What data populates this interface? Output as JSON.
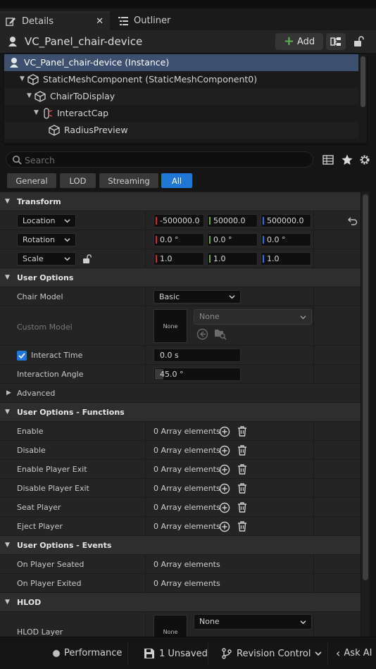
{
  "tabs": {
    "details_label": "Details",
    "close_glyph": "✕",
    "outliner_label": "Outliner"
  },
  "actor": {
    "name": "VC_Panel_chair-device",
    "add_label": "Add"
  },
  "tree": [
    {
      "label": "VC_Panel_chair-device (Instance)",
      "icon": "actor-icon"
    },
    {
      "label": "StaticMeshComponent (StaticMeshComponent0)",
      "icon": "cube-icon"
    },
    {
      "label": "ChairToDisplay",
      "icon": "cube-icon"
    },
    {
      "label": "InteractCap",
      "icon": "capsule-icon"
    },
    {
      "label": "RadiusPreview",
      "icon": "cube-icon"
    }
  ],
  "search": {
    "placeholder": "Search"
  },
  "filters": [
    "General",
    "LOD",
    "Streaming",
    "All"
  ],
  "active_filter": "All",
  "transform": {
    "header": "Transform",
    "location_label": "Location",
    "location": [
      "-500000.0",
      "50000.0",
      "500000.0"
    ],
    "rotation_label": "Rotation",
    "rotation": [
      "0.0 °",
      "0.0 °",
      "0.0 °"
    ],
    "scale_label": "Scale",
    "scale": [
      "1.0",
      "1.0",
      "1.0"
    ]
  },
  "user_options": {
    "header": "User Options",
    "chair_model_label": "Chair Model",
    "chair_model_value": "Basic",
    "custom_model_label": "Custom Model",
    "custom_model_thumb": "None",
    "custom_model_value": "None",
    "interact_time_label": "Interact Time",
    "interact_time_value": "0.0 s",
    "interaction_angle_label": "Interaction Angle",
    "interaction_angle_value": "45.0 °",
    "advanced_label": "Advanced"
  },
  "functions": {
    "header": "User Options - Functions",
    "rows": [
      {
        "label": "Enable",
        "value": "0 Array elements"
      },
      {
        "label": "Disable",
        "value": "0 Array elements"
      },
      {
        "label": "Enable Player Exit",
        "value": "0 Array elements"
      },
      {
        "label": "Disable Player Exit",
        "value": "0 Array elements"
      },
      {
        "label": "Seat Player",
        "value": "0 Array elements"
      },
      {
        "label": "Eject Player",
        "value": "0 Array elements"
      }
    ]
  },
  "events": {
    "header": "User Options - Events",
    "rows": [
      {
        "label": "On Player Seated",
        "value": "0 Array elements"
      },
      {
        "label": "On Player Exited",
        "value": "0 Array elements"
      }
    ]
  },
  "hlod": {
    "header": "HLOD",
    "layer_label": "HLOD Layer",
    "layer_thumb": "None",
    "layer_value": "None"
  },
  "status": {
    "performance": "Performance",
    "unsaved": "1 Unsaved",
    "revision": "Revision Control",
    "ask_ai": "Ask AI"
  },
  "colors": {
    "accent": "#1f78d6",
    "selection": "#3e5070",
    "x_axis": "#c8312a",
    "y_axis": "#6aaa2a",
    "z_axis": "#2f6fd8"
  }
}
